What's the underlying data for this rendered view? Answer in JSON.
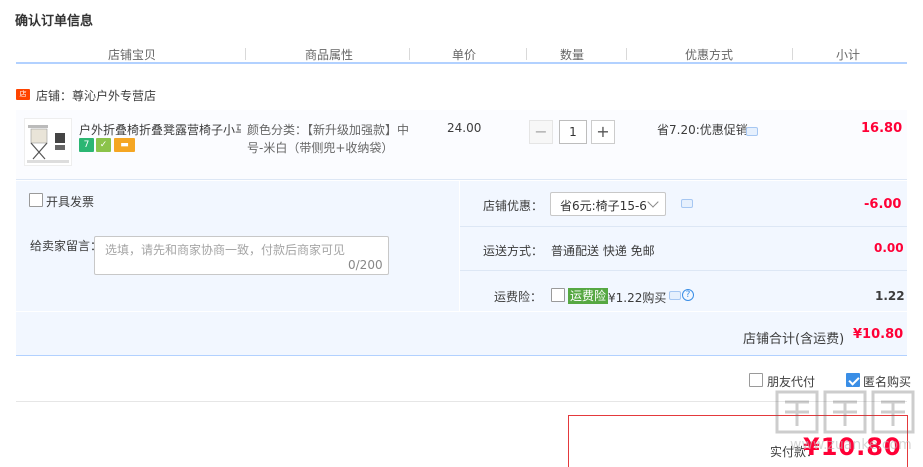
{
  "title": "确认订单信息",
  "columns": [
    "店铺宝贝",
    "商品属性",
    "单价",
    "数量",
    "优惠方式",
    "小计"
  ],
  "shop": {
    "label": "店铺：尊沁户外专营店",
    "icon": "shop-icon"
  },
  "item": {
    "name": "户外折叠椅折叠凳露营椅子小马...",
    "attr_line1": "颜色分类：【新升级加强款】中",
    "attr_line2": "号-米白（带侧兜+收纳袋）",
    "unit_price": "24.00",
    "quantity": "1",
    "promo": "省7.20:优惠促销",
    "subtotal": "16.80",
    "badges": [
      "7-day-return-icon",
      "service-icon",
      "card-icon"
    ]
  },
  "invoice": {
    "label": "开具发票"
  },
  "message": {
    "label": "给卖家留言：",
    "placeholder": "选填，请先和商家协商一致，付款后商家可见",
    "count": "0/200"
  },
  "shop_discount": {
    "label": "店铺优惠：",
    "selected": "省6元:椅子15-6",
    "amount": "-6.00"
  },
  "shipping": {
    "label": "运送方式：",
    "value": "普通配送 快递 免邮",
    "amount": "0.00"
  },
  "insurance": {
    "label": "运费险：",
    "tag": "运费险",
    "price": "¥1.22购买",
    "amount": "1.22"
  },
  "shop_total": {
    "label": "店铺合计(含运费)",
    "value": "¥10.80"
  },
  "options": {
    "friend_pay": "朋友代付",
    "anonymous": "匿名购买",
    "anonymous_checked": true
  },
  "payment": {
    "label": "实付款：",
    "value": "¥10.80"
  },
  "watermark": "www.zuanke.com",
  "colors": {
    "accent": "#ff0036",
    "blue_border": "#b2d1ff",
    "panel_bg": "#f2f7ff",
    "insurance_green": "#56a842"
  }
}
